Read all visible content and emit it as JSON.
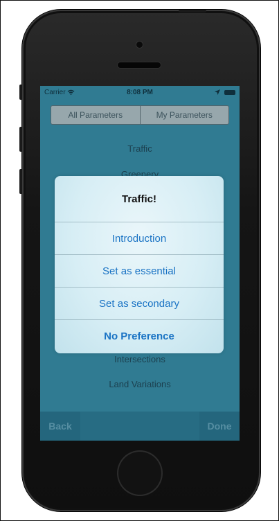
{
  "status_bar": {
    "carrier": "Carrier",
    "time": "8:08 PM"
  },
  "segmented": {
    "left": "All Parameters",
    "right": "My Parameters"
  },
  "list": {
    "items": [
      "Traffic",
      "Greenery",
      "Intersections",
      "Land Variations"
    ]
  },
  "alert": {
    "title": "Traffic!",
    "buttons": [
      "Introduction",
      "Set as essential",
      "Set as secondary",
      "No Preference"
    ]
  },
  "bottom_bar": {
    "back_label": "Back",
    "done_label": "Done"
  }
}
